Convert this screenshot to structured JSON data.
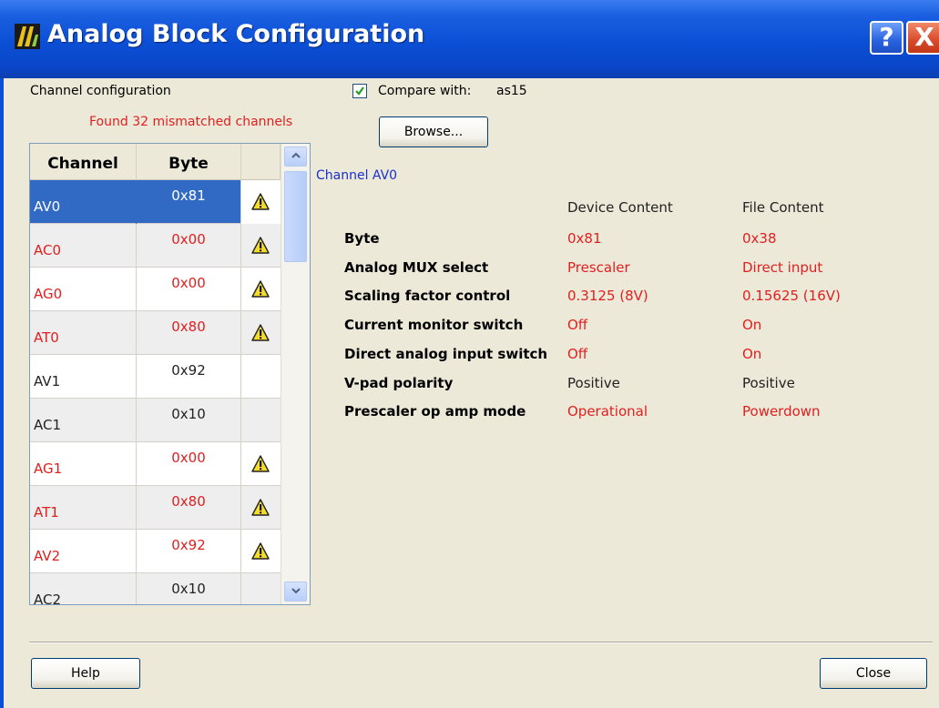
{
  "window": {
    "title": "Analog Block Configuration",
    "help_glyph": "?",
    "close_glyph": "X"
  },
  "channel_config": {
    "label": "Channel configuration",
    "mismatch_text": "Found 32 mismatched channels"
  },
  "compare": {
    "checked": true,
    "label": "Compare with:",
    "value": "as15",
    "browse_label": "Browse..."
  },
  "table": {
    "headers": [
      "Channel",
      "Byte"
    ],
    "rows": [
      {
        "channel": "AV0",
        "byte": "0x81",
        "warning": true,
        "mismatch": true,
        "selected": true
      },
      {
        "channel": "AC0",
        "byte": "0x00",
        "warning": true,
        "mismatch": true
      },
      {
        "channel": "AG0",
        "byte": "0x00",
        "warning": true,
        "mismatch": true
      },
      {
        "channel": "AT0",
        "byte": "0x80",
        "warning": true,
        "mismatch": true
      },
      {
        "channel": "AV1",
        "byte": "0x92",
        "warning": false,
        "mismatch": false
      },
      {
        "channel": "AC1",
        "byte": "0x10",
        "warning": false,
        "mismatch": false
      },
      {
        "channel": "AG1",
        "byte": "0x00",
        "warning": true,
        "mismatch": true
      },
      {
        "channel": "AT1",
        "byte": "0x80",
        "warning": true,
        "mismatch": true
      },
      {
        "channel": "AV2",
        "byte": "0x92",
        "warning": true,
        "mismatch": true
      },
      {
        "channel": "AC2",
        "byte": "0x10",
        "warning": false,
        "mismatch": false
      }
    ]
  },
  "detail": {
    "channel_title": "Channel AV0",
    "device_header": "Device Content",
    "file_header": "File Content",
    "properties": [
      {
        "name": "Byte",
        "device": "0x81",
        "file": "0x38",
        "mismatch": true
      },
      {
        "name": "Analog MUX select",
        "device": "Prescaler",
        "file": "Direct input",
        "mismatch": true
      },
      {
        "name": "Scaling factor control",
        "device": "0.3125 (8V)",
        "file": "0.15625 (16V)",
        "mismatch": true
      },
      {
        "name": "Current monitor switch",
        "device": "Off",
        "file": "On",
        "mismatch": true
      },
      {
        "name": "Direct analog input switch",
        "device": "Off",
        "file": "On",
        "mismatch": true
      },
      {
        "name": "V-pad polarity",
        "device": "Positive",
        "file": "Positive",
        "mismatch": false
      },
      {
        "name": "Prescaler op amp mode",
        "device": "Operational",
        "file": "Powerdown",
        "mismatch": true
      }
    ]
  },
  "footer": {
    "help_label": "Help",
    "close_label": "Close"
  },
  "colors": {
    "titlebar": "#0b4fd6",
    "mismatch": "#e02020",
    "selected_row": "#316ac5",
    "channel_title": "#1a2fd0"
  },
  "icons": {
    "app": "analog-block-app-icon",
    "warning": "warning-triangle-icon",
    "check": "checkmark-icon"
  }
}
